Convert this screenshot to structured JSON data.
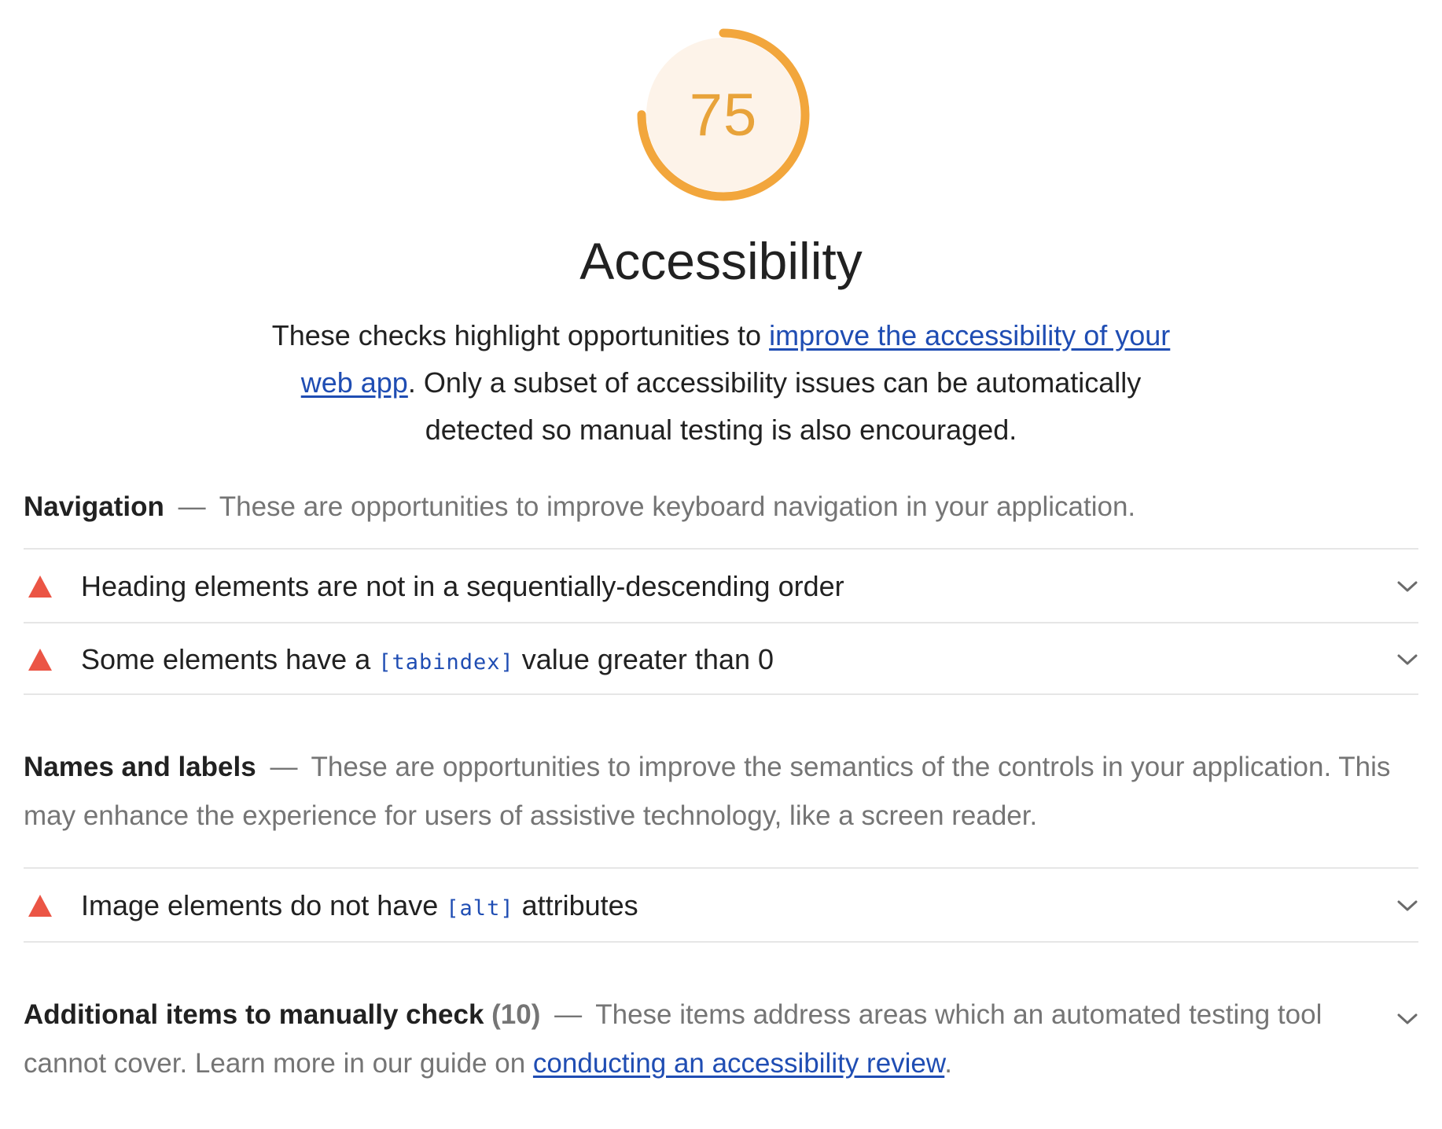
{
  "score": {
    "value": "75",
    "fraction": 0.75,
    "color": "#e8a33a",
    "track_fill": "#fdf3e9"
  },
  "category": {
    "title": "Accessibility",
    "description_before": "These checks highlight opportunities to ",
    "description_link": "improve the accessibility of your web app",
    "description_after": ". Only a subset of accessibility issues can be automatically detected so manual testing is also encouraged."
  },
  "groups": {
    "navigation": {
      "title": "Navigation",
      "separator": "—",
      "description": "These are opportunities to improve keyboard navigation in your application.",
      "audits": [
        {
          "icon": "warning-triangle-icon",
          "text": "Heading elements are not in a sequentially-descending order"
        },
        {
          "icon": "warning-triangle-icon",
          "text_before": "Some elements have a ",
          "code": "[tabindex]",
          "text_after": " value greater than 0"
        }
      ]
    },
    "names_labels": {
      "title": "Names and labels",
      "separator": "—",
      "description": "These are opportunities to improve the semantics of the controls in your application. This may enhance the experience for users of assistive technology, like a screen reader.",
      "audits": [
        {
          "icon": "warning-triangle-icon",
          "text_before": "Image elements do not have ",
          "code": "[alt]",
          "text_after": " attributes"
        }
      ]
    },
    "manual": {
      "title": "Additional items to manually check",
      "count": "(10)",
      "separator": "—",
      "description_before": "These items address areas which an automated testing tool cannot cover. Learn more in our guide on ",
      "link": "conducting an accessibility review",
      "description_after": "."
    }
  },
  "colors": {
    "fail_red": "#eb5545",
    "link_blue": "#1f4db3",
    "muted_text": "#757575",
    "divider": "#e6e6e6"
  }
}
